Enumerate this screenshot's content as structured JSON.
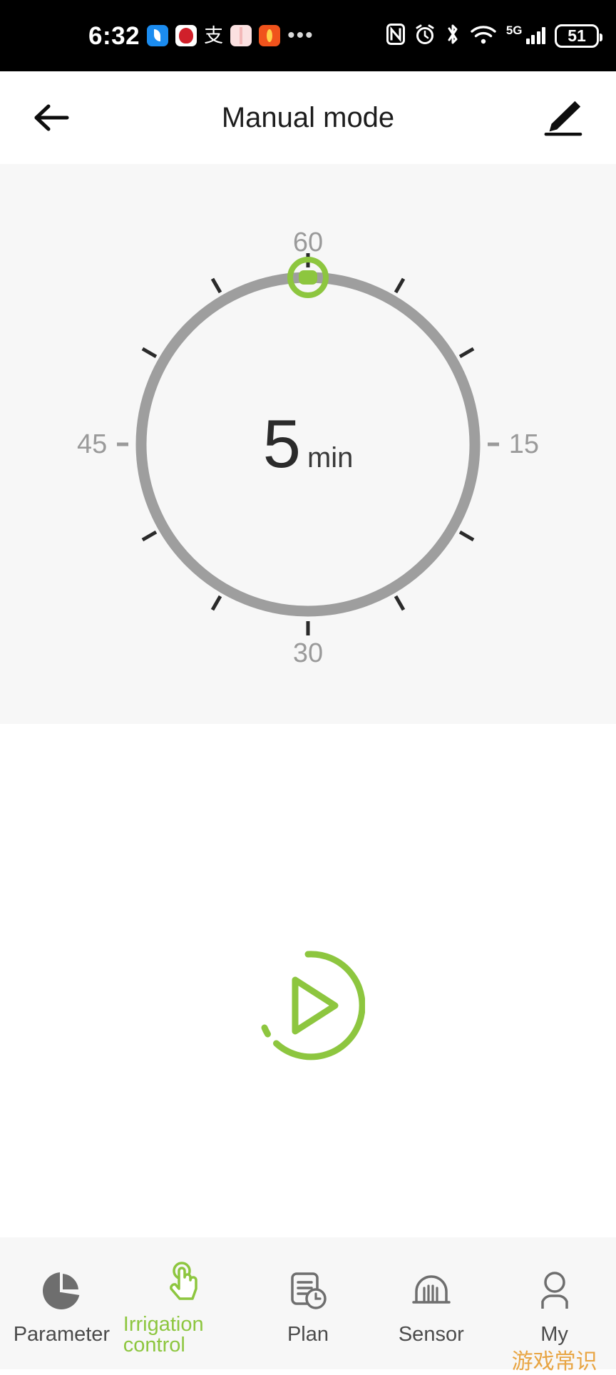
{
  "status_bar": {
    "time": "6:32",
    "battery_level": "51",
    "network": "5G",
    "icons": [
      "nfc-icon",
      "alarm-icon",
      "bluetooth-icon",
      "wifi-icon",
      "signal-icon",
      "battery-icon"
    ],
    "app_icons": [
      "messenger-icon",
      "jd-icon",
      "alipay-icon",
      "book-icon",
      "coupon-icon"
    ],
    "overflow": "•••",
    "alipay_glyph": "支"
  },
  "app_bar": {
    "title": "Manual mode",
    "back_icon": "back-arrow-icon",
    "edit_icon": "edit-pencil-icon"
  },
  "dial": {
    "value": "5",
    "unit": "min",
    "labels": {
      "top": "60",
      "right": "15",
      "bottom": "30",
      "left": "45"
    },
    "max_minutes": 60,
    "current_minutes": 5,
    "handle_angle_deg": 0,
    "track_color": "#9e9e9e",
    "accent_color": "#8dc63f",
    "card_background": "#f7f7f7"
  },
  "play": {
    "label": "start-irrigation",
    "icon": "play-circle-icon",
    "color": "#8dc63f"
  },
  "bottom_nav": {
    "items": [
      {
        "label": "Parameter",
        "icon": "pie-chart-icon",
        "active": false
      },
      {
        "label": "Irrigation control",
        "icon": "hand-tap-icon",
        "active": true
      },
      {
        "label": "Plan",
        "icon": "document-clock-icon",
        "active": false
      },
      {
        "label": "Sensor",
        "icon": "sensor-dome-icon",
        "active": false
      },
      {
        "label": "My",
        "icon": "person-icon",
        "active": false
      }
    ],
    "active_color": "#8dc63f",
    "inactive_color": "#4b4b4b"
  },
  "watermark": {
    "text": "游戏常识",
    "color": "#e8a13a"
  }
}
